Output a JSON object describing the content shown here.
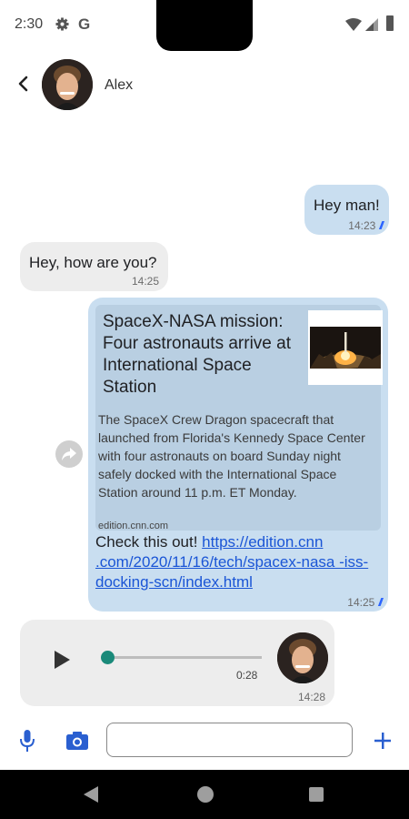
{
  "status_bar": {
    "time": "2:30",
    "icons": [
      "gear-icon",
      "google-icon",
      "wifi-icon",
      "signal-icon",
      "battery-icon"
    ],
    "google_letter": "G"
  },
  "header": {
    "contact_name": "Alex",
    "back_icon": "chevron-left-icon"
  },
  "messages": [
    {
      "direction": "outgoing",
      "text": "Hey man!",
      "time": "14:23",
      "ticks": "//"
    },
    {
      "direction": "incoming",
      "text": "Hey, how are you?",
      "time": "14:25"
    },
    {
      "direction": "outgoing",
      "link_preview": {
        "title": "SpaceX-NASA mission: Four astronauts arrive at International Space Station",
        "description": "The SpaceX Crew Dragon spacecraft that launched from Florida's Kennedy Space Center with four astronauts on board Sunday night safely docked with the International Space Station around 11 p.m. ET Monday.",
        "domain": "edition.cnn.com"
      },
      "text_prefix": "Check this out! ",
      "link": "https://edition.cnn.com/2020/11/16/tech/spacex-nasa-iss-docking-scn/index.html",
      "link_display": "https://edition.cnn .com/2020/11/16/tech/spacex-nasa -iss-docking-scn/index.html",
      "time": "14:25",
      "ticks": "//"
    },
    {
      "direction": "incoming",
      "type": "audio",
      "duration": "0:28",
      "progress": 0,
      "time": "14:28"
    }
  ],
  "composer": {
    "placeholder": "",
    "value": "",
    "icons": [
      "microphone-icon",
      "camera-icon",
      "plus-icon"
    ]
  },
  "colors": {
    "outgoing_bubble": "#c9def0",
    "incoming_bubble": "#ededed",
    "accent": "#2962ff",
    "link": "#1a55d6",
    "audio_knob": "#1a8a7a"
  }
}
